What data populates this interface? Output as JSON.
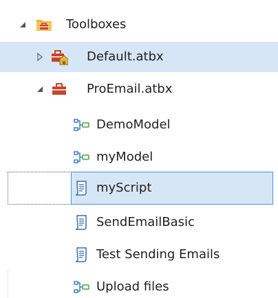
{
  "catalog": {
    "items": [
      {
        "label": "Toolboxes",
        "icon": "toolboxes-folder-icon",
        "expander": "expanded"
      },
      {
        "label": "Default.atbx",
        "icon": "default-toolbox-icon",
        "expander": "collapsed"
      },
      {
        "label": "ProEmail.atbx",
        "icon": "toolbox-icon",
        "expander": "expanded"
      },
      {
        "label": "DemoModel",
        "icon": "model-icon"
      },
      {
        "label": "myModel",
        "icon": "model-icon"
      },
      {
        "label": "myScript",
        "icon": "script-icon"
      },
      {
        "label": "SendEmailBasic",
        "icon": "script-icon"
      },
      {
        "label": "Test Sending Emails",
        "icon": "script-icon"
      },
      {
        "label": "Upload files",
        "icon": "model-icon"
      }
    ]
  },
  "colors": {
    "highlight": "#d6e6f6",
    "selection_border": "#4a90d9",
    "toolbox_red": "#c8442c",
    "folder_yellow": "#e8b43a",
    "model_blue": "#3a7fc8",
    "model_green": "#4aa04a"
  }
}
